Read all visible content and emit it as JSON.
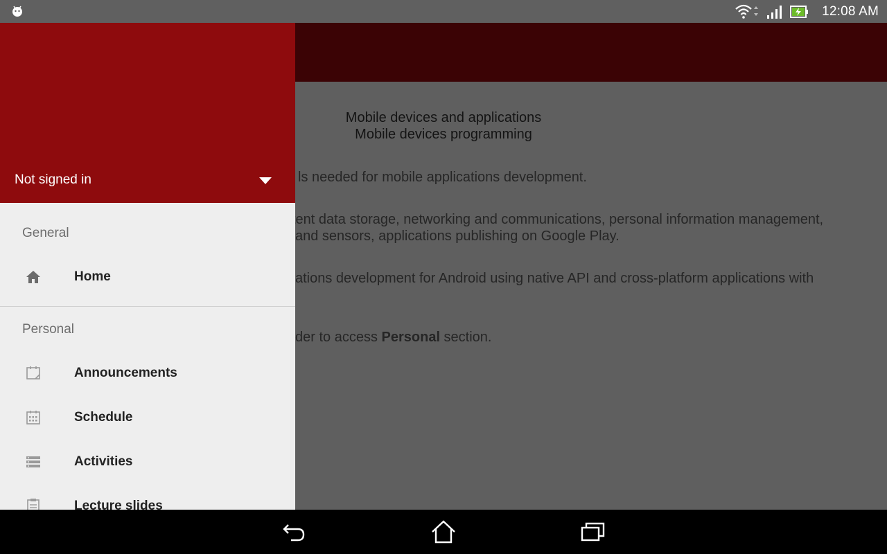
{
  "status_bar": {
    "left_icon": "android-debug-icon",
    "time": "12:08 AM",
    "icons": [
      "wifi-icon",
      "signal-icon",
      "battery-charging-icon"
    ]
  },
  "content": {
    "title_line1": "Mobile devices and applications",
    "title_line2": "Mobile devices programming",
    "para1": "ls needed for mobile applications development.",
    "para2_line1": "stent data storage, networking and communications, personal information management,",
    "para2_line2": "and sensors, applications publishing on Google Play.",
    "para3_line1": "ations development for Android using native API and cross-platform applications with",
    "para4_prefix": "der to access ",
    "para4_bold": "Personal",
    "para4_suffix": " section."
  },
  "drawer": {
    "account_label": "Not signed in",
    "sections": {
      "general": {
        "title": "General",
        "items": [
          {
            "label": "Home",
            "icon": "home-icon"
          }
        ]
      },
      "personal": {
        "title": "Personal",
        "items": [
          {
            "label": "Announcements",
            "icon": "announcement-icon"
          },
          {
            "label": "Schedule",
            "icon": "calendar-icon"
          },
          {
            "label": "Activities",
            "icon": "list-icon"
          },
          {
            "label": "Lecture slides",
            "icon": "clipboard-icon"
          }
        ]
      }
    }
  },
  "nav_bar": {
    "buttons": [
      "back-icon",
      "home-nav-icon",
      "recents-icon"
    ]
  },
  "colors": {
    "drawer_header": "#8e0b0d",
    "app_bar_dimmed": "#3b0305",
    "scrim_content": "#5f5f5f"
  }
}
